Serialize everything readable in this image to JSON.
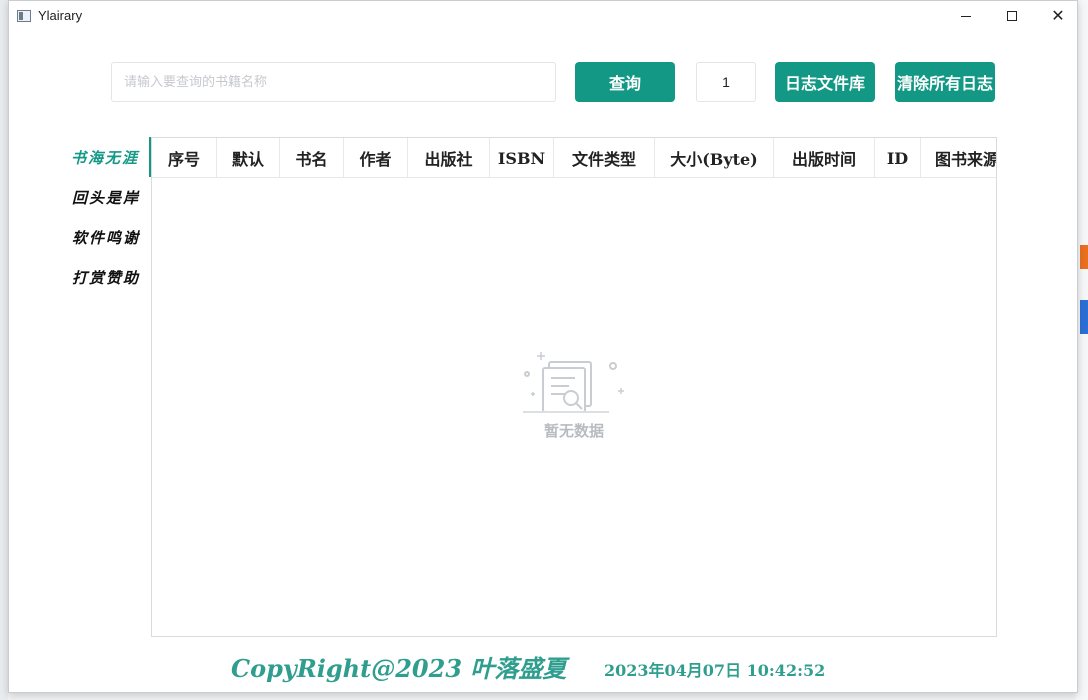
{
  "window": {
    "title": "Ylairary",
    "controls": {
      "minimize": "minimize-icon",
      "maximize": "maximize-icon",
      "close": "close-icon"
    }
  },
  "toolbar": {
    "search_placeholder": "请输入要查询的书籍名称",
    "search_value": "",
    "query_label": "查询",
    "page_value": "1",
    "log_library_label": "日志文件库",
    "clear_logs_label": "清除所有日志"
  },
  "nav": {
    "items": [
      {
        "label": "书海无涯",
        "active": true
      },
      {
        "label": "回头是岸",
        "active": false
      },
      {
        "label": "软件鸣谢",
        "active": false
      },
      {
        "label": "打赏赞助",
        "active": false
      }
    ]
  },
  "table": {
    "columns": [
      "序号",
      "默认",
      "书名",
      "作者",
      "出版社",
      "ISBN",
      "文件类型",
      "大小(Byte)",
      "出版时间",
      "ID",
      "图书来源"
    ],
    "rows": [],
    "empty_text": "暂无数据",
    "empty_icon": "empty-document-search-icon"
  },
  "footer": {
    "copyright": "CopyRight@2023 叶落盛夏",
    "datetime": "2023年04月07日 10:42:52"
  },
  "colors": {
    "accent": "#139885",
    "footer_text": "#2f9e8e",
    "placeholder": "#c6c9ce",
    "empty_text": "#b8bcc1"
  }
}
